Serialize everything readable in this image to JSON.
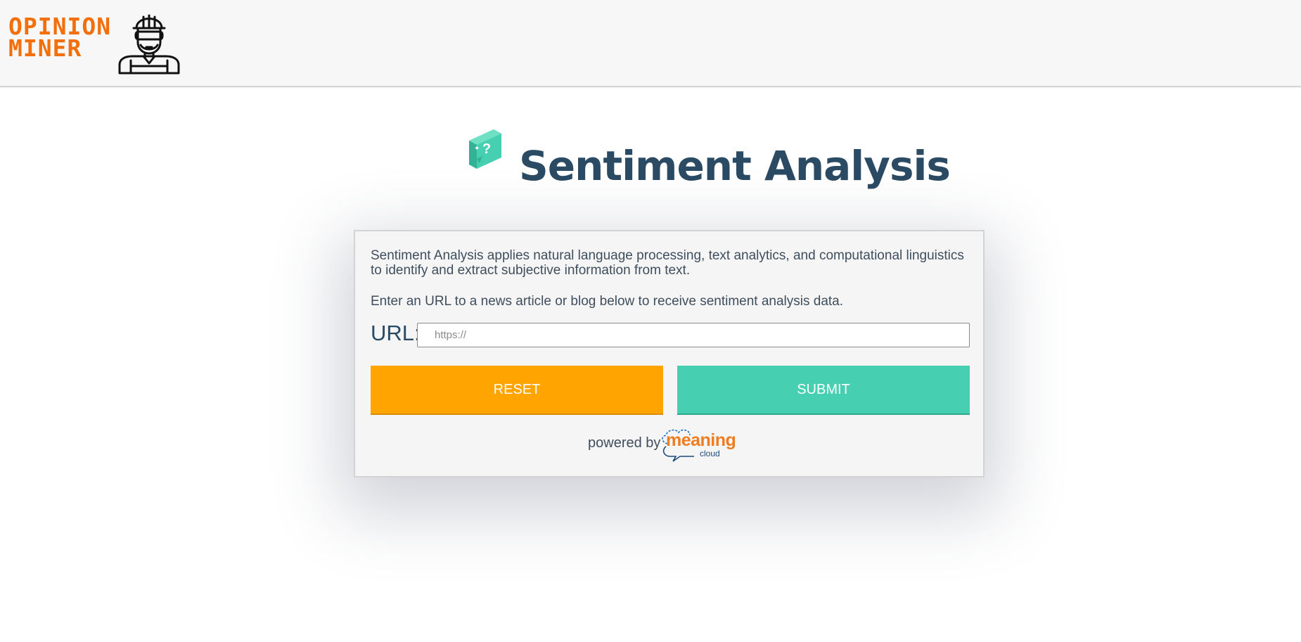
{
  "header": {
    "logo_line1": "OPINION",
    "logo_line2": "MINER",
    "logo_icon": "engineer-avatar-icon",
    "logo_color": "#f26f0c"
  },
  "main": {
    "title_icon": "speech-bubble-question-icon",
    "title": "Sentiment Analysis",
    "title_color": "#2b4a63"
  },
  "card": {
    "description": "Sentiment Analysis applies natural language processing, text analytics, and computational linguistics to identify and extract subjective information from text.",
    "instruction": "Enter an URL to a news article or blog below to receive sentiment analysis data.",
    "url_label": "URL:",
    "url_placeholder": "https://",
    "url_value": "",
    "reset_label": "RESET",
    "submit_label": "SUBMIT",
    "reset_color": "#ffa400",
    "submit_color": "#46cfb0",
    "powered_by": "powered by",
    "provider_word": "meaning",
    "provider_sub": "cloud",
    "provider_color": "#ee7d22"
  }
}
